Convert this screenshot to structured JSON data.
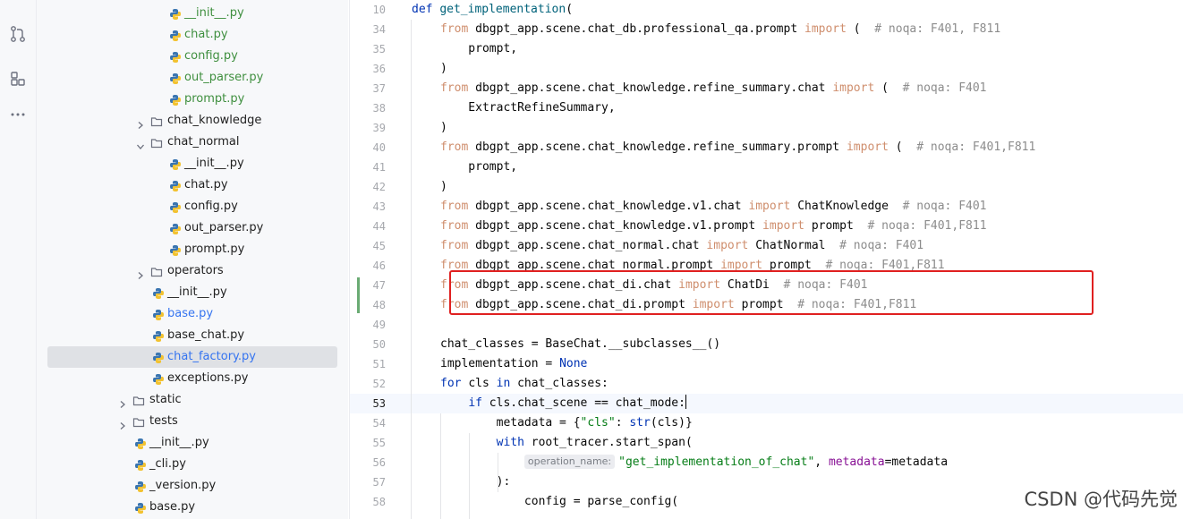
{
  "activity_bar": {
    "icons": [
      "commit-icon",
      "pull-requests-icon",
      "structure-icon",
      "more-icon"
    ]
  },
  "project_tree": {
    "items": [
      {
        "label": "__init__.py",
        "kind": "py",
        "color": "#3f8f3f"
      },
      {
        "label": "chat.py",
        "kind": "py",
        "color": "#3f8f3f"
      },
      {
        "label": "config.py",
        "kind": "py",
        "color": "#3f8f3f"
      },
      {
        "label": "out_parser.py",
        "kind": "py",
        "color": "#3f8f3f"
      },
      {
        "label": "prompt.py",
        "kind": "py",
        "color": "#3f8f3f"
      },
      {
        "label": "chat_knowledge",
        "kind": "folder",
        "expanded": false
      },
      {
        "label": "chat_normal",
        "kind": "folder",
        "expanded": true
      },
      {
        "label": "__init__.py",
        "kind": "py"
      },
      {
        "label": "chat.py",
        "kind": "py"
      },
      {
        "label": "config.py",
        "kind": "py"
      },
      {
        "label": "out_parser.py",
        "kind": "py"
      },
      {
        "label": "prompt.py",
        "kind": "py"
      },
      {
        "label": "operators",
        "kind": "folder",
        "expanded": false
      },
      {
        "label": "__init__.py",
        "kind": "py"
      },
      {
        "label": "base.py",
        "kind": "py",
        "color": "#3574f0"
      },
      {
        "label": "base_chat.py",
        "kind": "py"
      },
      {
        "label": "chat_factory.py",
        "kind": "py",
        "color": "#3574f0",
        "selected": true
      },
      {
        "label": "exceptions.py",
        "kind": "py"
      },
      {
        "label": "static",
        "kind": "folder",
        "expanded": false
      },
      {
        "label": "tests",
        "kind": "folder",
        "expanded": false
      },
      {
        "label": "__init__.py",
        "kind": "py"
      },
      {
        "label": "_cli.py",
        "kind": "py"
      },
      {
        "label": "_version.py",
        "kind": "py"
      },
      {
        "label": "base.py",
        "kind": "py"
      }
    ]
  },
  "editor": {
    "current_line": "53",
    "lines": [
      {
        "n": "10",
        "tokens": [
          [
            "kw",
            "def "
          ],
          [
            "fn",
            "get_implementation"
          ],
          [
            "",
            "("
          ]
        ]
      },
      {
        "n": "34",
        "tokens": [
          [
            "kw2",
            "from "
          ],
          [
            "",
            "dbgpt_app.scene.chat_db.professional_qa.prompt "
          ],
          [
            "kw2",
            "import "
          ],
          [
            "",
            "(  "
          ],
          [
            "cmt",
            "# noqa: F401, F811"
          ]
        ]
      },
      {
        "n": "35",
        "tokens": [
          [
            "",
            "    prompt,"
          ]
        ]
      },
      {
        "n": "36",
        "tokens": [
          [
            "",
            ")"
          ]
        ]
      },
      {
        "n": "37",
        "tokens": [
          [
            "kw2",
            "from "
          ],
          [
            "",
            "dbgpt_app.scene.chat_knowledge.refine_summary.chat "
          ],
          [
            "kw2",
            "import "
          ],
          [
            "",
            "(  "
          ],
          [
            "cmt",
            "# noqa: F401"
          ]
        ]
      },
      {
        "n": "38",
        "tokens": [
          [
            "",
            "    ExtractRefineSummary,"
          ]
        ]
      },
      {
        "n": "39",
        "tokens": [
          [
            "",
            ")"
          ]
        ]
      },
      {
        "n": "40",
        "tokens": [
          [
            "kw2",
            "from "
          ],
          [
            "",
            "dbgpt_app.scene.chat_knowledge.refine_summary.prompt "
          ],
          [
            "kw2",
            "import "
          ],
          [
            "",
            "(  "
          ],
          [
            "cmt",
            "# noqa: F401,F811"
          ]
        ]
      },
      {
        "n": "41",
        "tokens": [
          [
            "",
            "    prompt,"
          ]
        ]
      },
      {
        "n": "42",
        "tokens": [
          [
            "",
            ")"
          ]
        ]
      },
      {
        "n": "43",
        "tokens": [
          [
            "kw2",
            "from "
          ],
          [
            "",
            "dbgpt_app.scene.chat_knowledge.v1.chat "
          ],
          [
            "kw2",
            "import "
          ],
          [
            "",
            "ChatKnowledge  "
          ],
          [
            "cmt",
            "# noqa: F401"
          ]
        ]
      },
      {
        "n": "44",
        "tokens": [
          [
            "kw2",
            "from "
          ],
          [
            "",
            "dbgpt_app.scene.chat_knowledge.v1.prompt "
          ],
          [
            "kw2",
            "import "
          ],
          [
            "",
            "prompt  "
          ],
          [
            "cmt",
            "# noqa: F401,F811"
          ]
        ]
      },
      {
        "n": "45",
        "tokens": [
          [
            "kw2",
            "from "
          ],
          [
            "",
            "dbgpt_app.scene.chat_normal.chat "
          ],
          [
            "kw2",
            "import "
          ],
          [
            "",
            "ChatNormal  "
          ],
          [
            "cmt",
            "# noqa: F401"
          ]
        ]
      },
      {
        "n": "46",
        "tokens": [
          [
            "kw2",
            "from "
          ],
          [
            "",
            "dbgpt_app.scene.chat_normal.prompt "
          ],
          [
            "kw2",
            "import "
          ],
          [
            "",
            "prompt  "
          ],
          [
            "cmt",
            "# noqa: F401,F811"
          ]
        ]
      },
      {
        "n": "47",
        "tokens": [
          [
            "kw2",
            "from "
          ],
          [
            "",
            "dbgpt_app.scene.chat_di.chat "
          ],
          [
            "kw2",
            "import "
          ],
          [
            "",
            "ChatDi  "
          ],
          [
            "cmt",
            "# noqa: F401"
          ]
        ]
      },
      {
        "n": "48",
        "tokens": [
          [
            "kw2",
            "from "
          ],
          [
            "",
            "dbgpt_app.scene.chat_di.prompt "
          ],
          [
            "kw2",
            "import "
          ],
          [
            "",
            "prompt  "
          ],
          [
            "cmt",
            "# noqa: F401,F811"
          ]
        ]
      },
      {
        "n": "49",
        "tokens": []
      },
      {
        "n": "50",
        "tokens": [
          [
            "",
            "chat_classes = BaseChat.__subclasses__()"
          ]
        ]
      },
      {
        "n": "51",
        "tokens": [
          [
            "",
            "implementation = "
          ],
          [
            "kw",
            "None"
          ]
        ]
      },
      {
        "n": "52",
        "tokens": [
          [
            "kw",
            "for "
          ],
          [
            "",
            "cls "
          ],
          [
            "kw",
            "in "
          ],
          [
            "",
            "chat_classes:"
          ]
        ]
      },
      {
        "n": "53",
        "tokens": [
          [
            "",
            "    "
          ],
          [
            "kw",
            "if "
          ],
          [
            "",
            "cls.chat_scene == chat_mode:"
          ]
        ]
      },
      {
        "n": "54",
        "tokens": [
          [
            "",
            "        metadata = {"
          ],
          [
            "str",
            "\"cls\""
          ],
          [
            "",
            ": "
          ],
          [
            "bi",
            "str"
          ],
          [
            "",
            "(cls)}"
          ]
        ]
      },
      {
        "n": "55",
        "tokens": [
          [
            "",
            "        "
          ],
          [
            "kw",
            "with "
          ],
          [
            "",
            "root_tracer.start_span("
          ]
        ]
      },
      {
        "n": "56",
        "tokens": [
          [
            "",
            "            "
          ],
          [
            "hint",
            "operation_name:"
          ],
          [
            "str",
            "\"get_implementation_of_chat\""
          ],
          [
            "",
            ", "
          ],
          [
            "param",
            "metadata"
          ],
          [
            "",
            "=metadata"
          ]
        ]
      },
      {
        "n": "57",
        "tokens": [
          [
            "",
            "        ):"
          ]
        ]
      },
      {
        "n": "58",
        "tokens": [
          [
            "",
            "            config = parse_config("
          ]
        ]
      }
    ],
    "line_indents": [
      3,
      4,
      4,
      4,
      4,
      4,
      4,
      4,
      4,
      4,
      4,
      4,
      4,
      4,
      4,
      4,
      4,
      4,
      4,
      4,
      4,
      4,
      4,
      4,
      4,
      4
    ]
  },
  "watermark": "CSDN @代码先觉"
}
